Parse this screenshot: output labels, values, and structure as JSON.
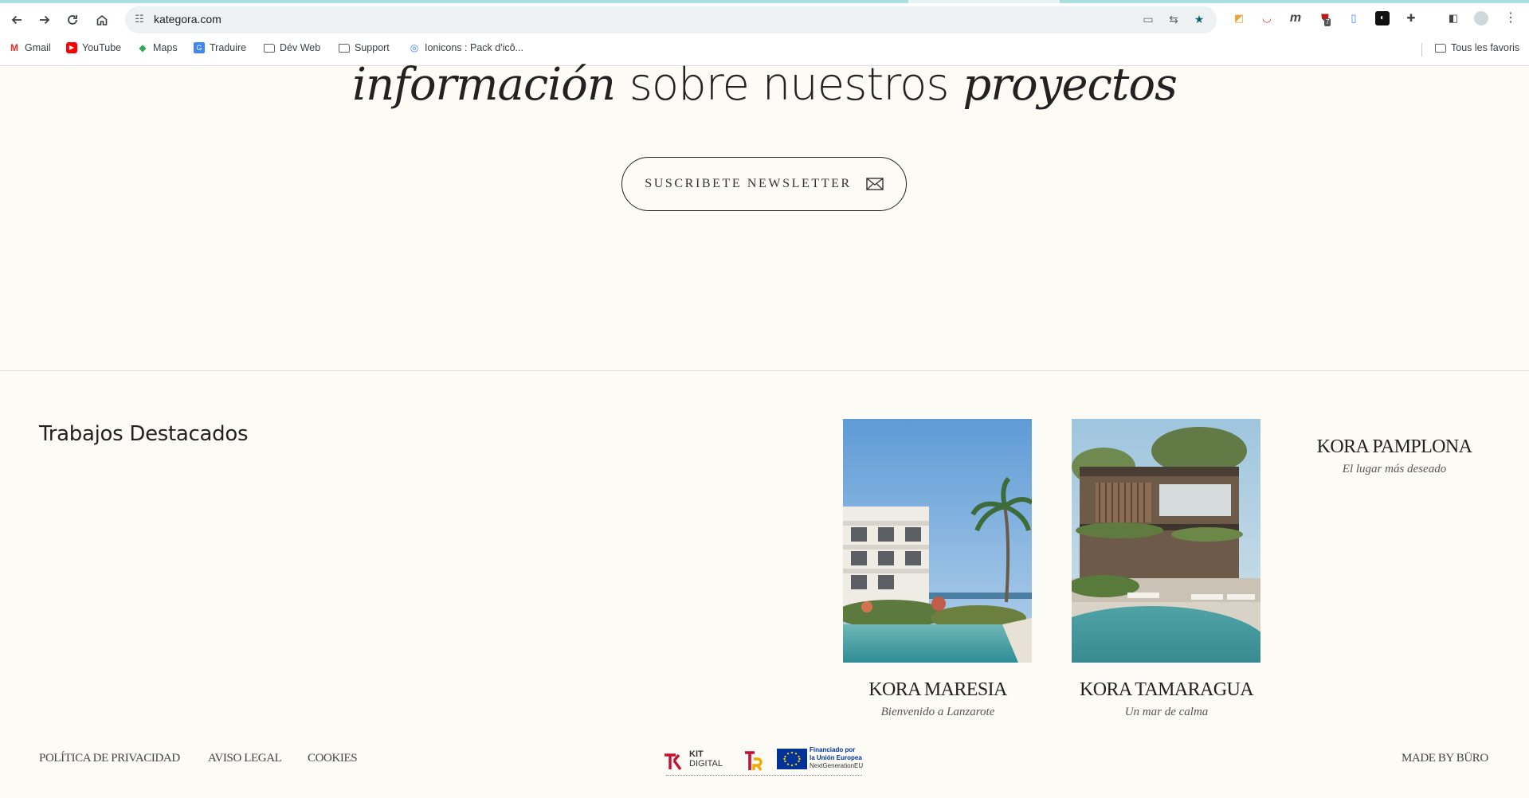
{
  "browser": {
    "url": "kategora.com",
    "bookmarks": [
      {
        "label": "Gmail",
        "icon": "gmail-icon"
      },
      {
        "label": "YouTube",
        "icon": "youtube-icon"
      },
      {
        "label": "Maps",
        "icon": "maps-icon"
      },
      {
        "label": "Traduire",
        "icon": "translate-icon"
      },
      {
        "label": "Dév Web",
        "icon": "folder-icon"
      },
      {
        "label": "Support",
        "icon": "folder-icon"
      },
      {
        "label": "Ionicons : Pack d'icô...",
        "icon": "ionicons-icon"
      }
    ],
    "all_bookmarks_label": "Tous les favoris",
    "extension_badge": "7"
  },
  "hero": {
    "word1": "información",
    "word2": "sobre nuestros",
    "word3": "proyectos"
  },
  "newsletter": {
    "label": "SUSCRIBETE NEWSLETTER"
  },
  "featured": {
    "title": "Trabajos Destacados",
    "projects": [
      {
        "name": "KORA MARESIA",
        "tagline": "Bienvenido a Lanzarote"
      },
      {
        "name": "KORA TAMARAGUA",
        "tagline": "Un mar de calma"
      },
      {
        "name": "KORA PAMPLONA",
        "tagline": "El lugar más deseado"
      }
    ]
  },
  "footer": {
    "links": [
      "POLÍTICA DE PRIVACIDAD",
      "AVISO LEGAL",
      "COOKIES"
    ],
    "credit": "MADE BY BÜRO",
    "logo_texts": {
      "kit": "KIT",
      "digital": "DIGITAL",
      "eu_line1": "Financiado por",
      "eu_line2": "la Unión Europea",
      "eu_line3": "NextGenerationEU"
    }
  },
  "colors": {
    "page_background": "#fdfbf6",
    "text": "#222222",
    "eu_blue": "#003399",
    "eu_yellow": "#ffcc00",
    "kit_red": "#c8102e"
  }
}
